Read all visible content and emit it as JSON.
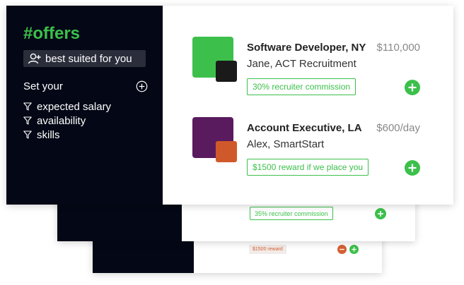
{
  "brand": "#offers",
  "search": {
    "label": "best suited for you",
    "icon": "add-user-icon"
  },
  "filter_section": {
    "title": "Set your",
    "add_icon": "plus-circle-icon",
    "items": [
      {
        "label": "expected salary",
        "icon": "filter-icon"
      },
      {
        "label": "availability",
        "icon": "filter-icon"
      },
      {
        "label": "skills",
        "icon": "filter-icon"
      }
    ]
  },
  "offers": [
    {
      "title": "Software Developer, NY",
      "salary": "$110,000",
      "company": "Jane, ACT Recruitment",
      "tag": "30% recruiter commission",
      "logo_colors": {
        "main": "#3cc04b",
        "accent": "#1a1a1a"
      }
    },
    {
      "title": "Account Executive, LA",
      "salary": "$600/day",
      "company": "Alex, SmartStart",
      "tag": "$1500 reward if we place you",
      "logo_colors": {
        "main": "#5a1a5e",
        "accent": "#d0592b"
      }
    }
  ],
  "back_cards": [
    {
      "tag": "35% recruiter commission"
    },
    {
      "tag": "$1500 reward"
    }
  ],
  "colors": {
    "accent_green": "#3cc04b",
    "sidebar_dark": "#040816",
    "reward_orange": "#d46032"
  }
}
